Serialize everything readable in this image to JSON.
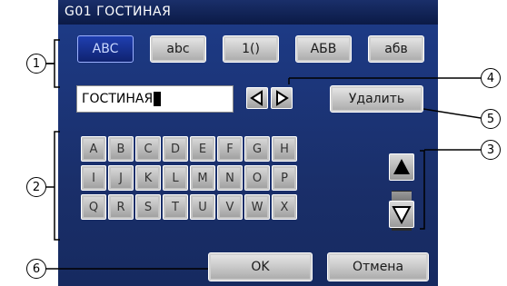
{
  "dialog": {
    "title": "G01 ГОСТИНАЯ"
  },
  "mode_tabs": [
    {
      "label": "ABC",
      "selected": true
    },
    {
      "label": "abc",
      "selected": false
    },
    {
      "label": "1()",
      "selected": false
    },
    {
      "label": "АБВ",
      "selected": false
    },
    {
      "label": "абв",
      "selected": false
    }
  ],
  "text_input": {
    "value": "ГОСТИНАЯ"
  },
  "cursor_buttons": {
    "left_icon": "arrow-left-icon",
    "right_icon": "arrow-right-icon"
  },
  "delete_button": {
    "label": "Удалить"
  },
  "keyboard": {
    "keys": [
      "A",
      "B",
      "C",
      "D",
      "E",
      "F",
      "G",
      "H",
      "I",
      "J",
      "K",
      "L",
      "M",
      "N",
      "O",
      "P",
      "Q",
      "R",
      "S",
      "T",
      "U",
      "V",
      "W",
      "X"
    ]
  },
  "scroll": {
    "up_icon": "arrow-up-icon",
    "down_icon": "arrow-down-icon"
  },
  "footer": {
    "ok_label": "OK",
    "cancel_label": "Отмена"
  },
  "callouts": [
    "1",
    "2",
    "3",
    "4",
    "5",
    "6"
  ],
  "colors": {
    "title_bar": "#0b1a46",
    "panel": "#1a2f6a",
    "selected_tab": "#1f3fb0",
    "button": "#c8c8c8"
  }
}
